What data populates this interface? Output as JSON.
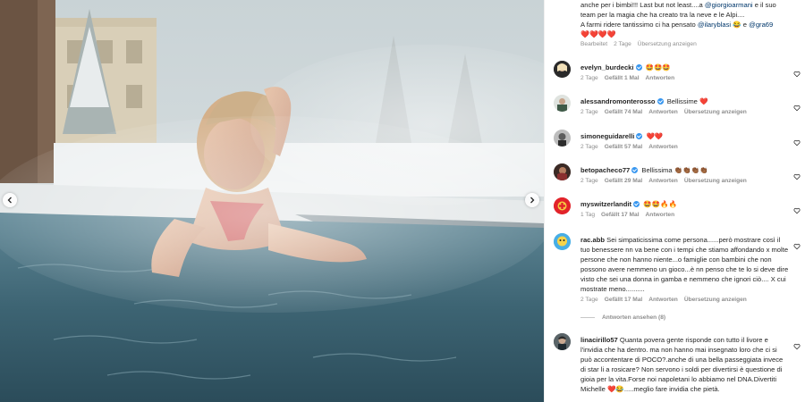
{
  "carousel": {
    "prev_icon": "chevron-left-icon",
    "next_icon": "chevron-right-icon"
  },
  "caption": {
    "line1_prefix": "anche per i bimbi!!! Last but not least....a ",
    "line1_mention": "@giorgioarmani",
    "line1_suffix": " e il suo",
    "line2": "team per la magia che ha creato tra la neve e le Alpi....",
    "line3_prefix": "A farmi ridere tantissimo ci ha pensato ",
    "line3_mention1": "@ilaryblasi",
    "line3_mid": " 😂 e ",
    "line3_mention2": "@gra69",
    "hearts": "❤️❤️❤️❤️",
    "meta_edited": "Bearbeitet",
    "meta_time": "2 Tage",
    "meta_translate": "Übersetzung anzeigen"
  },
  "comments": [
    {
      "user": "evelyn_burdecki",
      "verified": true,
      "text": "🤩🤩🤩",
      "time": "2 Tage",
      "likes": "Gefällt 1 Mal",
      "reply": "Antworten",
      "translate": ""
    },
    {
      "user": "alessandromonterosso",
      "verified": true,
      "text": "Bellissime ❤️",
      "time": "2 Tage",
      "likes": "Gefällt 74 Mal",
      "reply": "Antworten",
      "translate": "Übersetzung anzeigen"
    },
    {
      "user": "simoneguidarelli",
      "verified": true,
      "text": "❤️❤️",
      "time": "2 Tage",
      "likes": "Gefällt 57 Mal",
      "reply": "Antworten",
      "translate": ""
    },
    {
      "user": "betopacheco77",
      "verified": true,
      "text": "Bellissima 👏🏾👏🏾👏🏾👏🏾",
      "time": "2 Tage",
      "likes": "Gefällt 29 Mal",
      "reply": "Antworten",
      "translate": "Übersetzung anzeigen"
    },
    {
      "user": "myswitzerlandit",
      "verified": true,
      "text": "🤩🤩🔥🔥",
      "time": "1 Tag",
      "likes": "Gefällt 17 Mal",
      "reply": "Antworten",
      "translate": ""
    },
    {
      "user": "rac.abb",
      "verified": false,
      "text": "Sei simpaticissima come persona......però mostrare così il tuo benessere nn va bene con i tempi che stiamo affondando x molte persone che non hanno niente...o famiglie con bambini che non possono avere nemmeno un gioco...è nn penso che te lo si deve dire visto che sei una donna in gamba e nemmeno che ignori ciò.... X cui mostrate meno..........",
      "time": "2 Tage",
      "likes": "Gefällt 17 Mal",
      "reply": "Antworten",
      "translate": "Übersetzung anzeigen"
    },
    {
      "user": "linacirillo57",
      "verified": false,
      "text": "Quanta povera gente risponde con tutto il livore e l'invidia che ha dentro. ma non hanno mai insegnato loro che ci si può accontentare di POCO?.anche di una bella passeggiata invece di star li a rosicare? Non servono i soldi per divertirsi è questione di gioia per la vita.Forse noi napoletani lo abbiamo nel DNA.Divertiti Michelle ❤️😂.....meglio fare invidia che pietà.",
      "time": "",
      "likes": "",
      "reply": "",
      "translate": ""
    }
  ],
  "view_replies": "Antworten ansehen (8)",
  "colors": {
    "link": "#00376b",
    "heart": "#ed4956",
    "verified": "#3897f0",
    "meta": "#8e8e8e"
  }
}
